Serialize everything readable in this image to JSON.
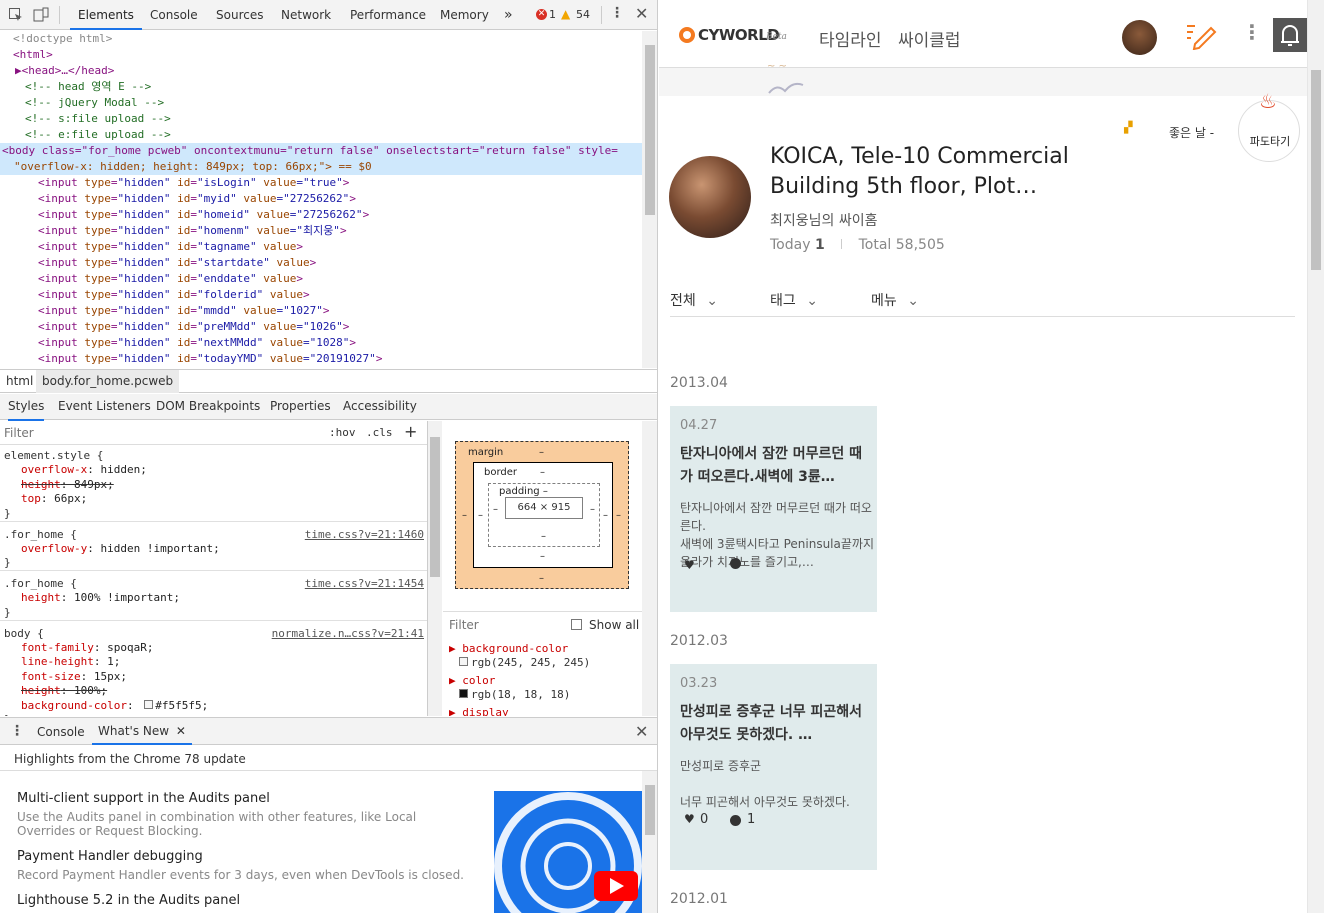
{
  "devtools": {
    "tabs": [
      "Elements",
      "Console",
      "Sources",
      "Network",
      "Performance",
      "Memory"
    ],
    "more_tabs": "»",
    "error_count": "1",
    "warning_count": "54",
    "elements": {
      "lines": [
        {
          "t": "dc",
          "text": "<!doctype html>"
        },
        {
          "t": "tg",
          "text": "<html>"
        },
        {
          "t": "tg",
          "text": "▶<head>…</head>"
        },
        {
          "t": "cm",
          "text": "<!-- head 영역 E -->"
        },
        {
          "t": "cm",
          "text": "<!-- jQuery Modal -->"
        },
        {
          "t": "cm",
          "text": "<!-- s:file upload -->"
        },
        {
          "t": "cm",
          "text": "<!-- e:file upload -->"
        }
      ],
      "body_line": "<body class=\"for_home pcweb\" oncontextmunu=\"return false\" onselectstart=\"return false\" style=",
      "body_line2": "\"overflow-x: hidden; height: 849px; top: 66px;\"> == $0",
      "inputs": [
        {
          "id": "isLogin",
          "value": "true"
        },
        {
          "id": "myid",
          "value": "27256262"
        },
        {
          "id": "homeid",
          "value": "27256262"
        },
        {
          "id": "homenm",
          "value": "최지웅"
        },
        {
          "id": "tagname",
          "value": ""
        },
        {
          "id": "startdate",
          "value": ""
        },
        {
          "id": "enddate",
          "value": ""
        },
        {
          "id": "folderid",
          "value": ""
        },
        {
          "id": "mmdd",
          "value": "1027"
        },
        {
          "id": "preMMdd",
          "value": "1026"
        },
        {
          "id": "nextMMdd",
          "value": "1028"
        },
        {
          "id": "todayYMD",
          "value": "20191027"
        }
      ]
    },
    "breadcrumbs": [
      "html",
      "body.for_home.pcweb"
    ],
    "subtabs": [
      "Styles",
      "Event Listeners",
      "DOM Breakpoints",
      "Properties",
      "Accessibility"
    ],
    "styles": {
      "filter_placeholder": "Filter",
      "hov": ":hov",
      "cls": ".cls",
      "add": "+",
      "rules": [
        {
          "selector": "element.style {",
          "source": "",
          "props": [
            {
              "p": "overflow-x",
              "v": "hidden;",
              "strike": false
            },
            {
              "p": "height",
              "v": "849px;",
              "strike": true
            },
            {
              "p": "top",
              "v": "66px;",
              "strike": false
            }
          ]
        },
        {
          "selector": ".for_home {",
          "source": "time.css?v=21:1460",
          "props": [
            {
              "p": "overflow-y",
              "v": "hidden !important;",
              "strike": false
            }
          ]
        },
        {
          "selector": ".for_home {",
          "source": "time.css?v=21:1454",
          "props": [
            {
              "p": "height",
              "v": "100% !important;",
              "strike": false
            }
          ]
        },
        {
          "selector": "body {",
          "source": "normalize.n…css?v=21:41",
          "props": [
            {
              "p": "font-family",
              "v": "spoqaR;",
              "strike": false
            },
            {
              "p": "line-height",
              "v": "1;",
              "strike": false
            },
            {
              "p": "font-size",
              "v": "15px;",
              "strike": false
            },
            {
              "p": "height",
              "v": "100%;",
              "strike": true
            },
            {
              "p": "background-color",
              "v": "#f5f5f5;",
              "strike": false
            }
          ]
        }
      ]
    },
    "box_model": {
      "margin_label": "margin",
      "border_label": "border",
      "padding_label": "padding –",
      "content": "664 × 915",
      "dash": "–"
    },
    "computed": {
      "filter_placeholder": "Filter",
      "show_all": "Show all",
      "props": [
        {
          "name": "background-color",
          "value": "rgb(245, 245, 245)",
          "swatch": "#f5f5f5"
        },
        {
          "name": "color",
          "value": "rgb(18, 18, 18)",
          "swatch": "#121212"
        },
        {
          "name": "display",
          "value": "",
          "swatch": ""
        }
      ]
    },
    "drawer": {
      "tabs": [
        "Console",
        "What's New"
      ],
      "header": "Highlights from the Chrome 78 update",
      "items": [
        {
          "title": "Multi-client support in the Audits panel",
          "desc": "Use the Audits panel in combination with other features, like Local Overrides or Request Blocking."
        },
        {
          "title": "Payment Handler debugging",
          "desc": "Record Payment Handler events for 3 days, even when DevTools is closed."
        },
        {
          "title": "Lighthouse 5.2 in the Audits panel",
          "desc": ""
        }
      ]
    }
  },
  "page": {
    "logo_text": "CYWORLD",
    "logo_beta": "Beta",
    "nav": [
      "타임라인",
      "싸이클럽"
    ],
    "brand_color": "#f47a20",
    "profile": {
      "title": "KOICA, Tele-10 Commercial Building 5th floor, Plot…",
      "subtitle": "최지웅님의 싸이홈",
      "today_label": "Today",
      "today_value": "1",
      "total_label": "Total",
      "total_value": "58,505",
      "mood": "좋은 날 -",
      "badge": "파도타기"
    },
    "filters": [
      "전체",
      "태그",
      "메뉴"
    ],
    "groups": [
      {
        "month": "2013.04",
        "posts": [
          {
            "date": "04.27",
            "title": "탄자니아에서 잠깐 머무르던 때가 떠오른다.새벽에 3륜…",
            "body": "탄자니아에서 잠깐 머무르던 때가 떠오른다.\n새벽에 3륜택시타고 Peninsula끝까지 올라가 치지노를 즐기고,…",
            "likes": "",
            "comments": ""
          }
        ]
      },
      {
        "month": "2012.03",
        "posts": [
          {
            "date": "03.23",
            "title": "만성피로 증후군 너무 피곤해서 아무것도 못하겠다. …",
            "body": "만성피로 증후군\n\n너무 피곤해서 아무것도 못하겠다.",
            "likes": "0",
            "comments": "1"
          }
        ]
      },
      {
        "month": "2012.01",
        "posts": []
      }
    ]
  }
}
